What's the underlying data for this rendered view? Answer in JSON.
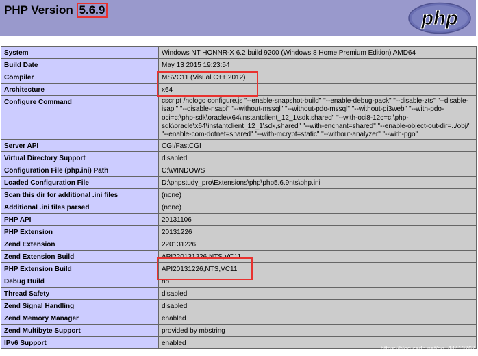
{
  "header": {
    "title_prefix": "PHP Version ",
    "version": "5.6.9",
    "logo_text": "php"
  },
  "rows": [
    {
      "key": "System",
      "value": "Windows NT HONNR-X 6.2 build 9200 (Windows 8 Home Premium Edition) AMD64"
    },
    {
      "key": "Build Date",
      "value": "May 13 2015 19:23:54"
    },
    {
      "key": "Compiler",
      "value": "MSVC11 (Visual C++ 2012)"
    },
    {
      "key": "Architecture",
      "value": "x64"
    },
    {
      "key": "Configure Command",
      "value": "cscript /nologo configure.js \"--enable-snapshot-build\" \"--enable-debug-pack\" \"--disable-zts\" \"--disable-isapi\" \"--disable-nsapi\" \"--without-mssql\" \"--without-pdo-mssql\" \"--without-pi3web\" \"--with-pdo-oci=c:\\php-sdk\\oracle\\x64\\instantclient_12_1\\sdk,shared\" \"--with-oci8-12c=c:\\php-sdk\\oracle\\x64\\instantclient_12_1\\sdk,shared\" \"--with-enchant=shared\" \"--enable-object-out-dir=../obj/\" \"--enable-com-dotnet=shared\" \"--with-mcrypt=static\" \"--without-analyzer\" \"--with-pgo\""
    },
    {
      "key": "Server API",
      "value": "CGI/FastCGI"
    },
    {
      "key": "Virtual Directory Support",
      "value": "disabled"
    },
    {
      "key": "Configuration File (php.ini) Path",
      "value": "C:\\WINDOWS"
    },
    {
      "key": "Loaded Configuration File",
      "value": "D:\\phpstudy_pro\\Extensions\\php\\php5.6.9nts\\php.ini"
    },
    {
      "key": "Scan this dir for additional .ini files",
      "value": "(none)"
    },
    {
      "key": "Additional .ini files parsed",
      "value": "(none)"
    },
    {
      "key": "PHP API",
      "value": "20131106"
    },
    {
      "key": "PHP Extension",
      "value": "20131226"
    },
    {
      "key": "Zend Extension",
      "value": "220131226"
    },
    {
      "key": "Zend Extension Build",
      "value": "API220131226,NTS,VC11"
    },
    {
      "key": "PHP Extension Build",
      "value": "API20131226,NTS,VC11"
    },
    {
      "key": "Debug Build",
      "value": "no"
    },
    {
      "key": "Thread Safety",
      "value": "disabled"
    },
    {
      "key": "Zend Signal Handling",
      "value": "disabled"
    },
    {
      "key": "Zend Memory Manager",
      "value": "enabled"
    },
    {
      "key": "Zend Multibyte Support",
      "value": "provided by mbstring"
    },
    {
      "key": "IPv6 Support",
      "value": "enabled"
    }
  ],
  "watermark": "https://blog.csdn.net/qq_44413767",
  "colors": {
    "header_bg": "#9999cc",
    "key_bg": "#ccccff",
    "value_bg": "#cccccc",
    "highlight": "#e8322f"
  }
}
